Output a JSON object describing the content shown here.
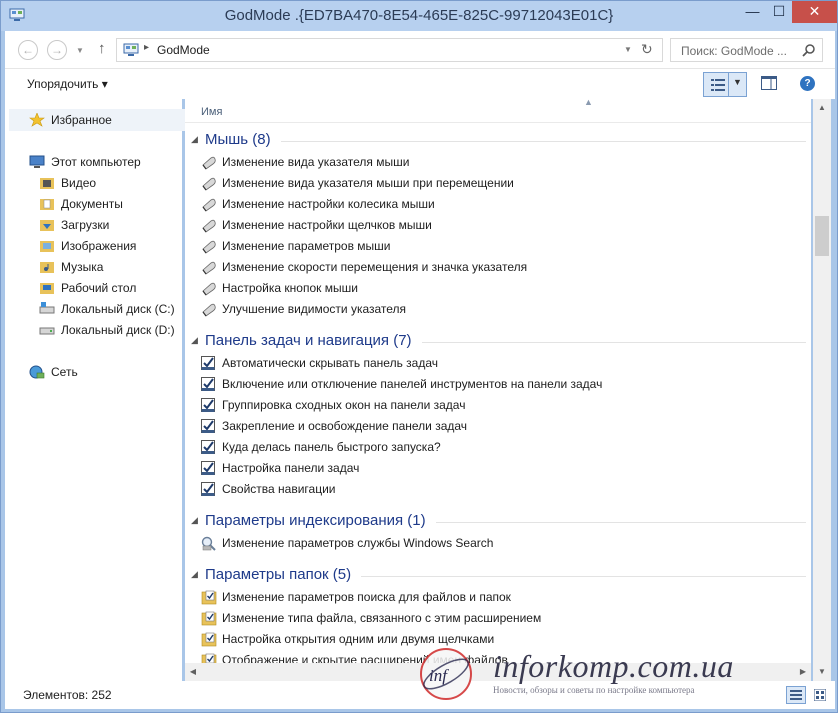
{
  "window": {
    "title": "GodMode .{ED7BA470-8E54-465E-825C-99712043E01C}",
    "minimize_glyph": "—",
    "maximize_glyph": "☐",
    "close_glyph": "✕"
  },
  "navigation": {
    "back_glyph": "←",
    "forward_glyph": "→",
    "up_glyph": "↑",
    "address_path": "GodMode",
    "address_separator": "▸",
    "refresh_glyph": "↻",
    "search_placeholder": "Поиск: GodMode ..."
  },
  "toolbar": {
    "organize_label": "Упорядочить ▾",
    "help_glyph": "?"
  },
  "sidebar": {
    "favorites": "Избранное",
    "computer": "Этот компьютер",
    "computer_items": [
      "Видео",
      "Документы",
      "Загрузки",
      "Изображения",
      "Музыка",
      "Рабочий стол",
      "Локальный диск (C:)",
      "Локальный диск (D:)"
    ],
    "network": "Сеть"
  },
  "content": {
    "column_name": "Имя",
    "groups": [
      {
        "title": "Мышь (8)",
        "icon": "mouse-icon",
        "items": [
          "Изменение вида указателя мыши",
          "Изменение вида указателя мыши при перемещении",
          "Изменение настройки колесика мыши",
          "Изменение настройки щелчков мыши",
          "Изменение параметров мыши",
          "Изменение скорости перемещения и значка указателя",
          "Настройка кнопок мыши",
          "Улучшение видимости указателя"
        ]
      },
      {
        "title": "Панель задач и навигация (7)",
        "icon": "taskbar-icon",
        "items": [
          "Автоматически скрывать панель задач",
          "Включение или отключение панелей инструментов на панели задач",
          "Группировка сходных окон на панели задач",
          "Закрепление и освобождение панели задач",
          "Куда делась панель быстрого запуска?",
          "Настройка панели задач",
          "Свойства навигации"
        ]
      },
      {
        "title": "Параметры индексирования (1)",
        "icon": "indexing-icon",
        "items": [
          "Изменение параметров службы Windows Search"
        ]
      },
      {
        "title": "Параметры папок (5)",
        "icon": "folder-options-icon",
        "items": [
          "Изменение параметров поиска для файлов и папок",
          "Изменение типа файла, связанного с этим расширением",
          "Настройка открытия одним или двумя щелчками",
          "Отображение и скрытие расширений имен файлов"
        ]
      }
    ]
  },
  "status": {
    "items_count": "Элементов: 252"
  },
  "watermark": {
    "text": "inforkomp.com.ua",
    "subtitle": "Новости, обзоры и советы по настройке компьютера"
  },
  "colors": {
    "titlebar": "#b7d0ef",
    "group_title": "#1e3a8a",
    "close_button": "#c7504a"
  }
}
